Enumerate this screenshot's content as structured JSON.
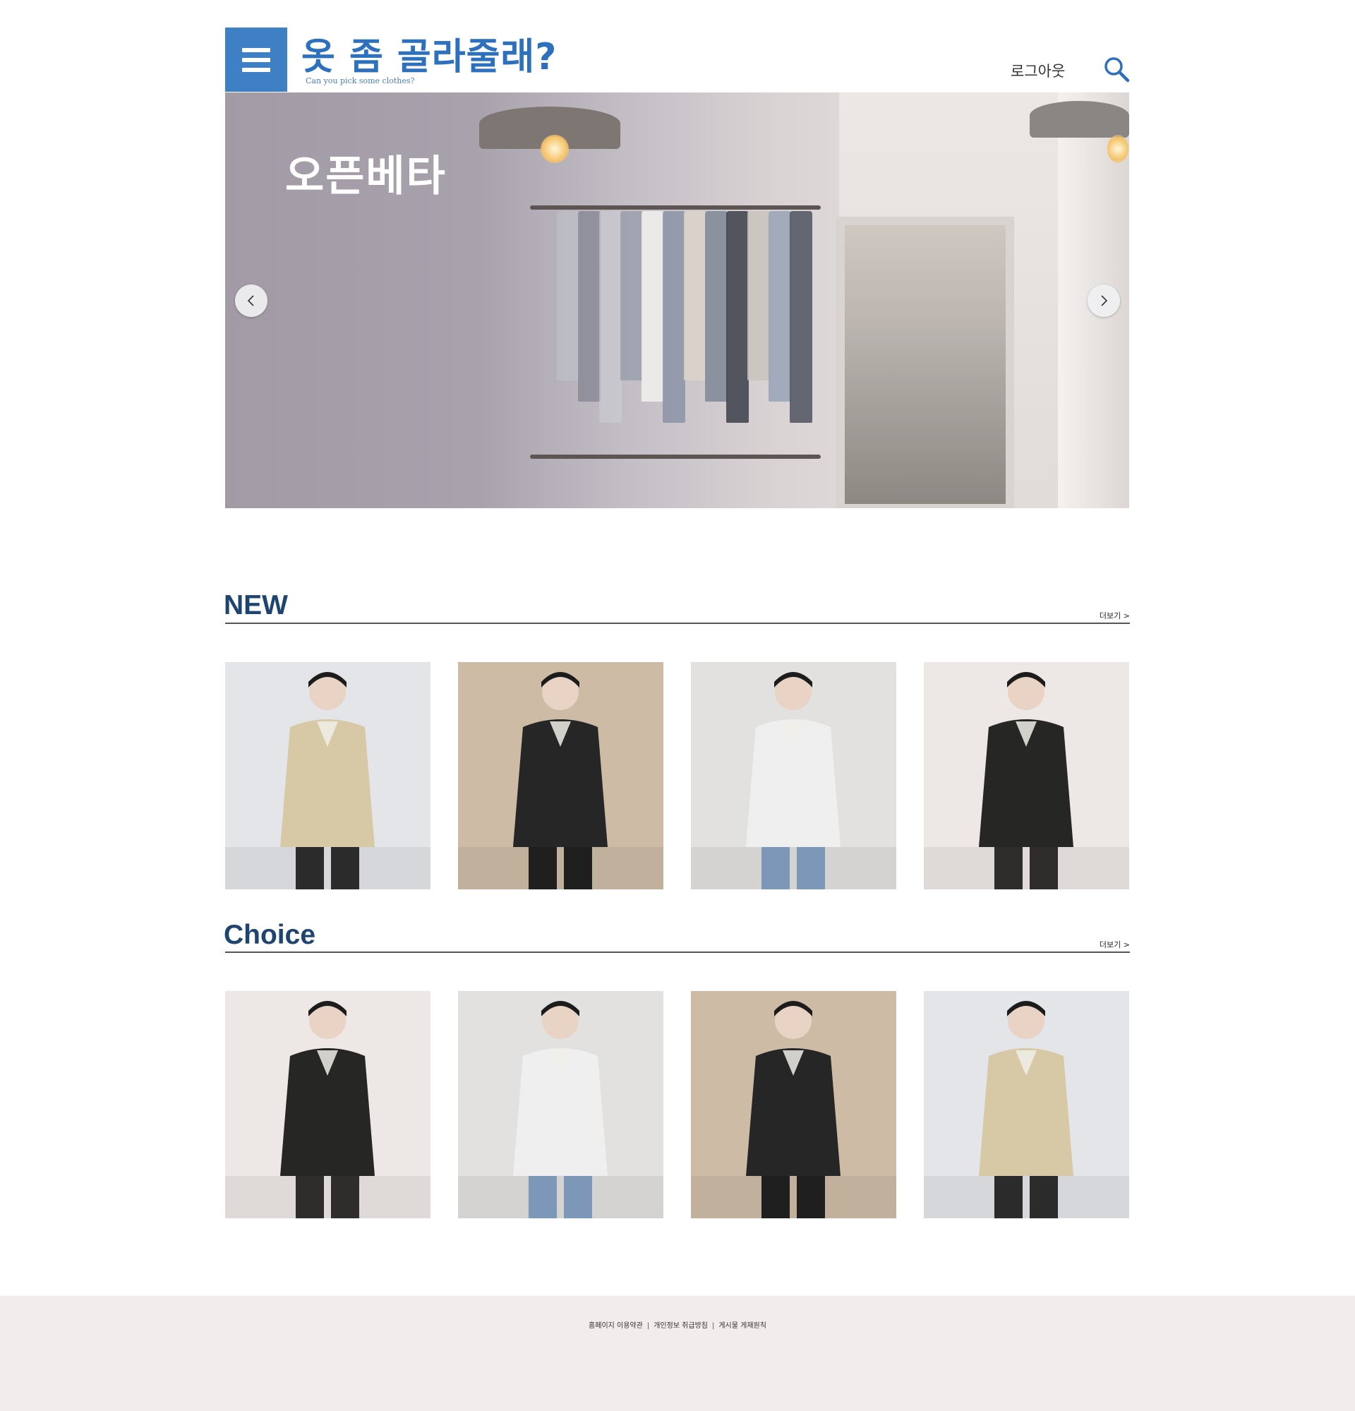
{
  "header": {
    "logo_title": "옷 좀 골라줄래?",
    "logo_subtitle": "Can you pick some clothes?",
    "logout_label": "로그아웃",
    "brand_color": "#3f7fc6",
    "menu_icon": "hamburger-menu-icon",
    "search_icon": "search-icon"
  },
  "hero": {
    "title": "오픈베타",
    "prev_icon": "chevron-left-icon",
    "next_icon": "chevron-right-icon"
  },
  "sections": [
    {
      "title": "NEW",
      "more_label": "더보기 >",
      "products": [
        {
          "item": "beige denim jacket",
          "bg": "#e3e5e8",
          "top": "#d8c9a6",
          "bottom": "#2b2b2b"
        },
        {
          "item": "black leather rider jacket",
          "bg": "#cdbba6",
          "top": "#262626",
          "bottom": "#1f1f1f"
        },
        {
          "item": "light wash wide jeans",
          "bg": "#e2e1df",
          "top": "#efefef",
          "bottom": "#7d97b8"
        },
        {
          "item": "black work jacket with bucket hat",
          "bg": "#ede7e6",
          "top": "#262624",
          "bottom": "#2e2d2b"
        }
      ]
    },
    {
      "title": "Choice",
      "more_label": "더보기 >",
      "products": [
        {
          "item": "black work jacket with bucket hat",
          "bg": "#ede7e6",
          "top": "#262624",
          "bottom": "#2e2d2b"
        },
        {
          "item": "light wash wide jeans",
          "bg": "#e2e1df",
          "top": "#efefef",
          "bottom": "#7d97b8"
        },
        {
          "item": "black leather rider jacket",
          "bg": "#cdbba6",
          "top": "#262626",
          "bottom": "#1f1f1f"
        },
        {
          "item": "beige denim jacket",
          "bg": "#e3e5e8",
          "top": "#d8c9a6",
          "bottom": "#2b2b2b"
        }
      ]
    }
  ],
  "footer": {
    "links": [
      "홈페이지 이용약관",
      "개인정보 취급방침",
      "게시물 게재원칙"
    ],
    "separator": "|"
  },
  "colors": {
    "section_title": "#1e4470",
    "footer_bg": "#f1edec"
  }
}
